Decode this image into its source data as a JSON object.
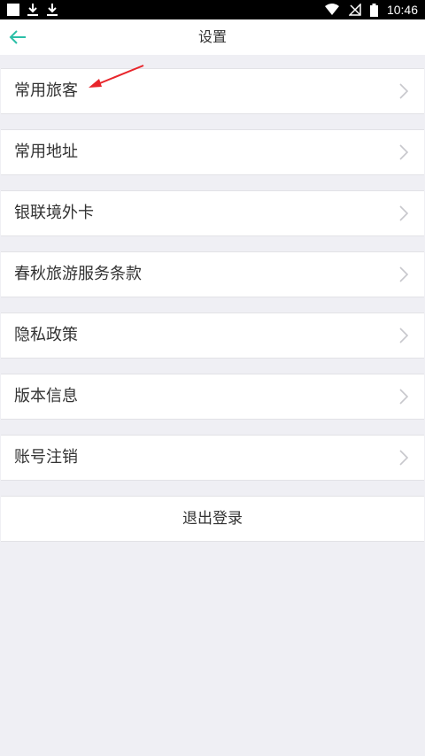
{
  "status_bar": {
    "time": "10:46",
    "icons": [
      "app-square-icon",
      "download-icon",
      "download-icon",
      "wifi-icon",
      "no-signal-icon",
      "battery-icon"
    ]
  },
  "nav": {
    "title": "设置",
    "back_icon": "arrow-left-icon",
    "accent_color": "#2bbfa7"
  },
  "settings_items": [
    {
      "label": "常用旅客"
    },
    {
      "label": "常用地址"
    },
    {
      "label": "银联境外卡"
    },
    {
      "label": "春秋旅游服务条款"
    },
    {
      "label": "隐私政策"
    },
    {
      "label": "版本信息"
    },
    {
      "label": "账号注销"
    }
  ],
  "logout_label": "退出登录",
  "annotation_arrow_color": "#e8252b"
}
